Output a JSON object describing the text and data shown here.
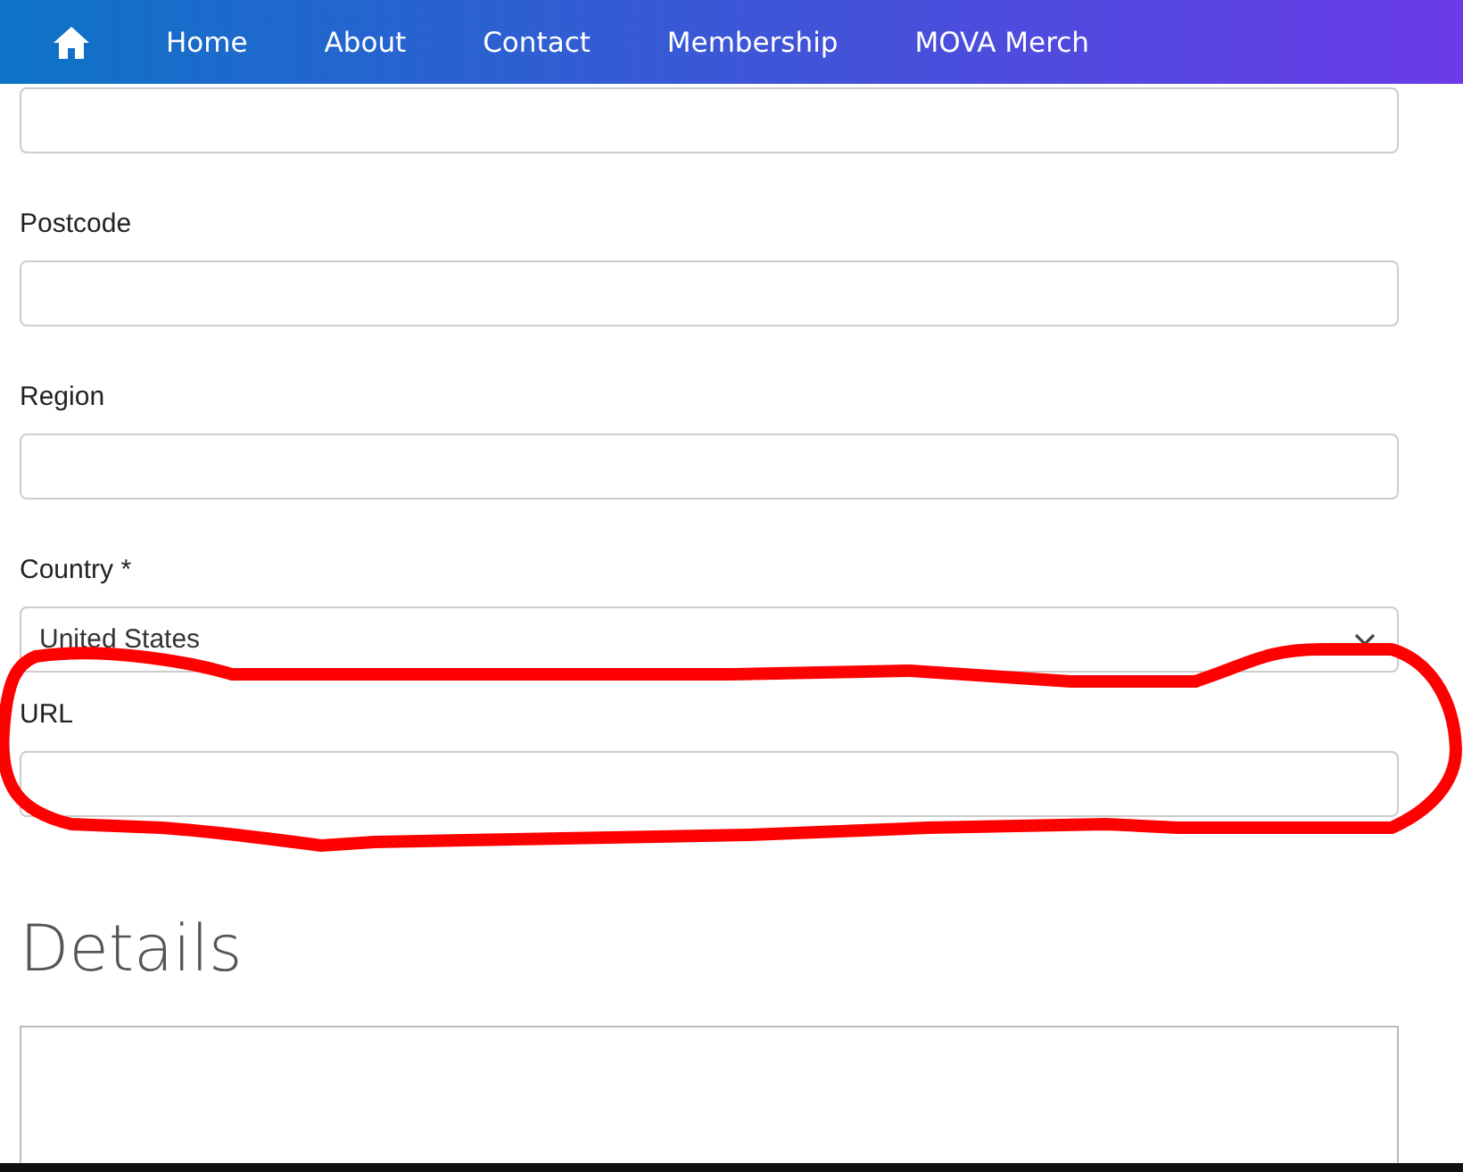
{
  "nav": {
    "items": [
      {
        "label": "Home"
      },
      {
        "label": "About"
      },
      {
        "label": "Contact"
      },
      {
        "label": "Membership"
      },
      {
        "label": "MOVA Merch"
      }
    ]
  },
  "form": {
    "fields": [
      {
        "kind": "input"
      },
      {
        "kind": "input",
        "label": "Postcode"
      },
      {
        "kind": "input",
        "label": "Region"
      },
      {
        "kind": "select",
        "label": "Country *",
        "value": "United States"
      },
      {
        "kind": "input",
        "label": "URL"
      }
    ]
  },
  "details": {
    "heading": "Details",
    "fields": [
      {
        "kind": "textarea"
      }
    ]
  }
}
